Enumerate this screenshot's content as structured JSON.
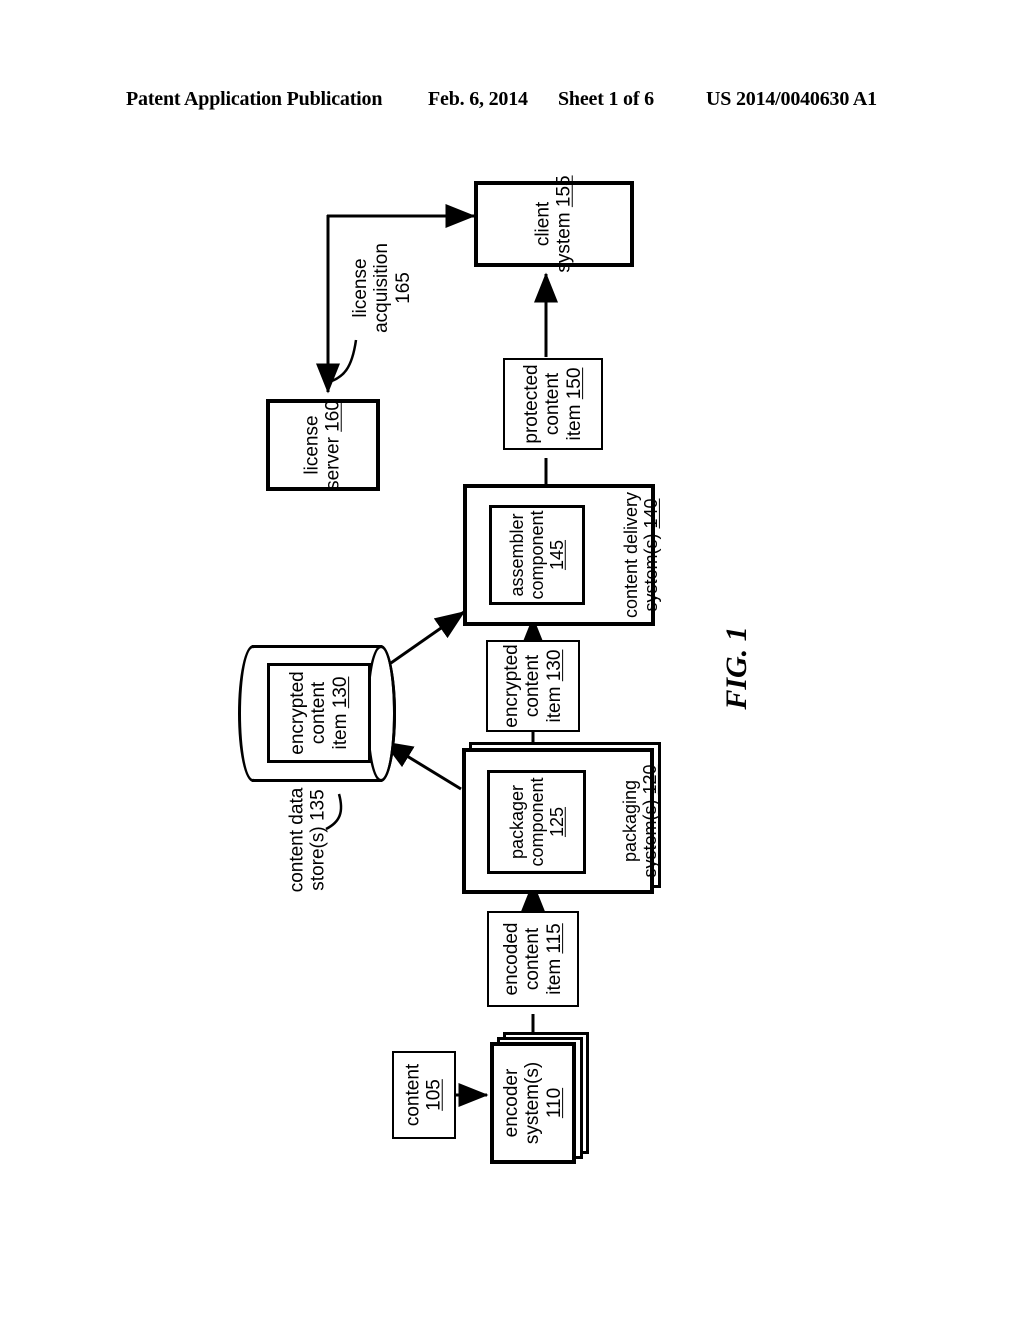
{
  "header": {
    "publication": "Patent Application Publication",
    "date": "Feb. 6, 2014",
    "sheet": "Sheet 1 of 6",
    "patent_number": "US 2014/0040630 A1"
  },
  "figure": {
    "label": "FIG. 1",
    "orientation": "rotated-90-ccw",
    "type": "block-diagram"
  },
  "nodes": {
    "content": {
      "line1": "content",
      "ref": "105"
    },
    "encoder_systems": {
      "line1": "encoder",
      "line2": "system(s)",
      "ref": "110"
    },
    "encoded_content_item": {
      "line1": "encoded",
      "line2": "content",
      "line3": "item",
      "ref": "115"
    },
    "packaging_systems": {
      "line1": "packaging",
      "line2": "system(s)",
      "ref": "120"
    },
    "packager_component": {
      "line1": "packager",
      "line2": "component",
      "ref": "125"
    },
    "encrypted_content_item_store": {
      "line1": "encrypted",
      "line2": "content",
      "line3": "item",
      "ref": "130"
    },
    "encrypted_content_item_flow": {
      "line1": "encrypted",
      "line2": "content",
      "line3": "item",
      "ref": "130"
    },
    "content_data_store": {
      "line1": "content data",
      "line2": "store(s) 135",
      "ref": "135"
    },
    "content_delivery_systems": {
      "line1": "content delivery",
      "line2": "system(s)",
      "ref": "140"
    },
    "assembler_component": {
      "line1": "assembler",
      "line2": "component",
      "ref": "145"
    },
    "protected_content_item": {
      "line1": "protected",
      "line2": "content",
      "line3": "item",
      "ref": "150"
    },
    "client_system": {
      "line1": "client",
      "line2": "system",
      "ref": "155"
    },
    "license_server": {
      "line1": "license",
      "line2": "server",
      "ref": "160"
    },
    "license_acquisition": {
      "line1": "license",
      "line2": "acquisition",
      "ref": "165"
    }
  },
  "edges": [
    {
      "from": "content",
      "to": "encoder_systems"
    },
    {
      "from": "encoder_systems",
      "to": "encoded_content_item"
    },
    {
      "from": "encoded_content_item",
      "to": "packaging_systems"
    },
    {
      "from": "packaging_systems",
      "to": "encrypted_content_item_flow"
    },
    {
      "from": "packaging_systems",
      "to": "content_data_store"
    },
    {
      "from": "encrypted_content_item_flow",
      "to": "content_delivery_systems"
    },
    {
      "from": "content_data_store",
      "to": "content_delivery_systems"
    },
    {
      "from": "content_delivery_systems",
      "to": "protected_content_item"
    },
    {
      "from": "protected_content_item",
      "to": "client_system"
    },
    {
      "from": "client_system",
      "to": "license_server",
      "label": "license_acquisition"
    }
  ],
  "colors": {
    "ink": "#000000",
    "paper": "#ffffff"
  }
}
